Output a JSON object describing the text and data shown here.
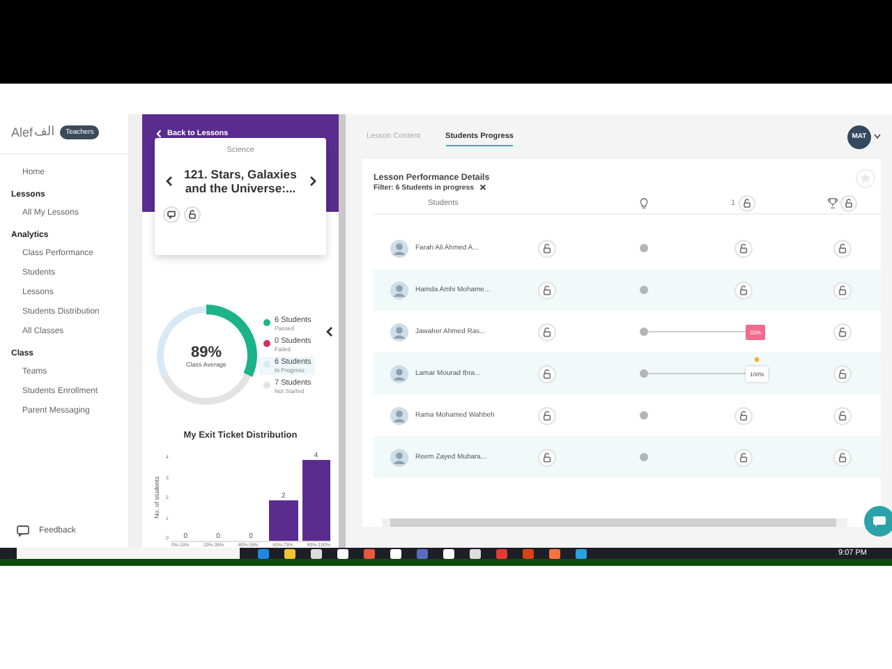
{
  "sidebar": {
    "logo": {
      "latin": "Alef",
      "arabic": "الف"
    },
    "role_badge": "Teachers",
    "sections": [
      {
        "items": [
          {
            "label": "Home",
            "selected": false
          }
        ]
      },
      {
        "title": "Lessons",
        "items": [
          {
            "label": "All My Lessons",
            "selected": false
          }
        ]
      },
      {
        "title": "Analytics",
        "items": [
          {
            "label": "Class Performance",
            "selected": false
          },
          {
            "label": "Students",
            "selected": false
          },
          {
            "label": "Lessons",
            "selected": false
          },
          {
            "label": "Students Distribution",
            "selected": false
          },
          {
            "label": "All Classes",
            "selected": false
          }
        ]
      },
      {
        "title": "Class",
        "items": [
          {
            "label": "Teams",
            "selected": false
          },
          {
            "label": "Students Enrollment",
            "selected": false
          },
          {
            "label": "Parent Messaging",
            "selected": false
          }
        ]
      }
    ],
    "feedback": "Feedback"
  },
  "lesson_panel": {
    "back": "Back to Lessons",
    "subject": "Science",
    "title": "121. Stars, Galaxies and the Universe:...",
    "summary": {
      "average": "89%",
      "average_label": "Class Average",
      "legend": [
        {
          "count": "6 Students",
          "status": "Passed",
          "color": "#1db38a",
          "selected": false
        },
        {
          "count": "0 Students",
          "status": "Failed",
          "color": "#d6325a",
          "selected": false
        },
        {
          "count": "6 Students",
          "status": "In Progress",
          "color": "#d8e9f5",
          "selected": true
        },
        {
          "count": "7 Students",
          "status": "Not Started",
          "color": "#e3e3e3",
          "selected": false
        }
      ]
    },
    "distribution": {
      "title": "My Exit Ticket Distribution",
      "chart_data": {
        "type": "bar",
        "ylabel": "No. of students",
        "categories": [
          "0%-19%",
          "20%-39%",
          "40%-59%",
          "60%-79%",
          "80%-100%"
        ],
        "series": [
          {
            "color": "#5b2c8f",
            "values": [
              0,
              0,
              0,
              2,
              4
            ]
          }
        ],
        "ylim": [
          0,
          4
        ],
        "yticks": [
          0,
          1,
          2,
          3,
          4
        ],
        "data_labels": true
      }
    }
  },
  "tabs": [
    {
      "label": "Lesson Content",
      "selected": false
    },
    {
      "label": "Students Progress",
      "selected": true
    }
  ],
  "user": {
    "initials": "MAT"
  },
  "details": {
    "title": "Lesson Performance Details",
    "filter": "Filter: 6 Students in progress",
    "close": "×",
    "columns": [
      {
        "kind": "text",
        "label": "Students"
      },
      {
        "kind": "bulb"
      },
      {
        "kind": "lock",
        "label": "1"
      },
      {
        "kind": "trophy"
      }
    ],
    "rows": [
      {
        "name": "Farah Ali Ahmed A...",
        "progress": null
      },
      {
        "name": "Hamda Amhi Mohame...",
        "progress": null
      },
      {
        "name": "Jawaher Ahmed Ras...",
        "progress": {
          "label": "33%",
          "passed": false
        }
      },
      {
        "name": "Lamar Mourad Ibra...",
        "progress": {
          "label": "100%",
          "passed": true
        }
      },
      {
        "name": "Rama Mohamed Wahbeh",
        "progress": null
      },
      {
        "name": "Reem Zayed Mubara...",
        "progress": null
      }
    ]
  },
  "taskbar": {
    "time": "9:07 PM"
  }
}
